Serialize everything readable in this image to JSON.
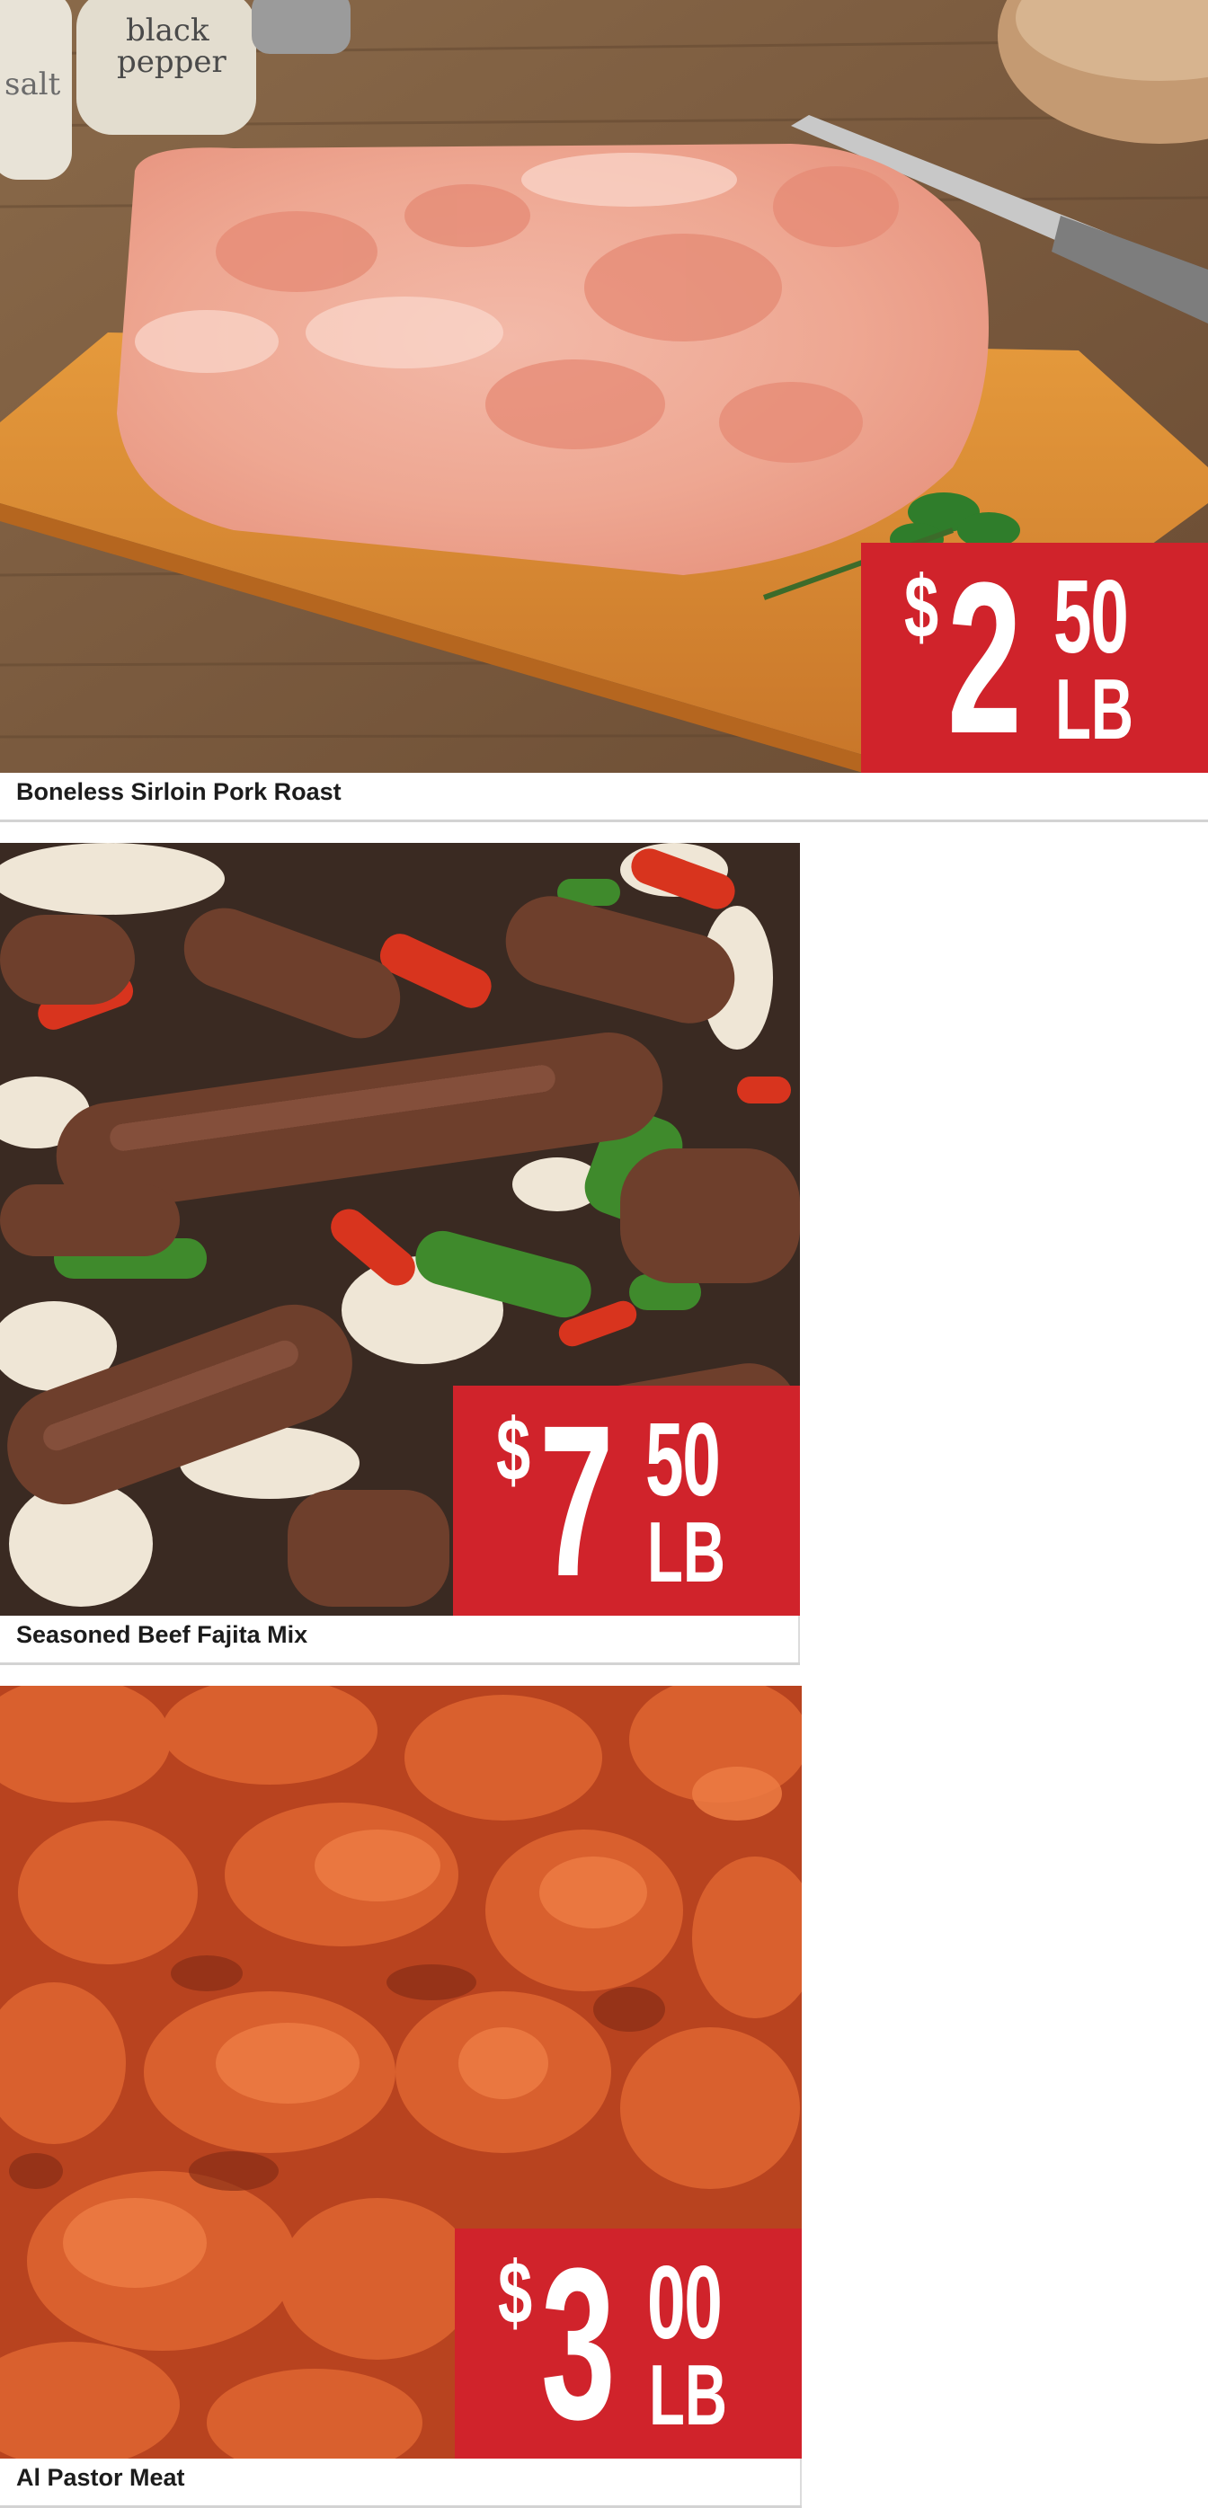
{
  "products": [
    {
      "name": "Boneless Sirloin Pork Roast",
      "image": "pork-roast-photo",
      "price": {
        "currency": "$",
        "whole": "2",
        "cents": "50",
        "unit": "LB"
      },
      "photo_text": {
        "jar_left": "salt",
        "jar_right_line1": "black",
        "jar_right_line2": "pepper"
      }
    },
    {
      "name": "Seasoned Beef Fajita Mix",
      "image": "beef-fajita-photo",
      "price": {
        "currency": "$",
        "whole": "7",
        "cents": "50",
        "unit": "LB"
      }
    },
    {
      "name": "Al Pastor Meat",
      "image": "al-pastor-photo",
      "price": {
        "currency": "$",
        "whole": "3",
        "cents": "00",
        "unit": "LB"
      }
    }
  ],
  "colors": {
    "price_badge": "#d0232b",
    "price_text": "#ffffff",
    "caption_text": "#1c1c1c",
    "divider": "#d3d3d3"
  }
}
